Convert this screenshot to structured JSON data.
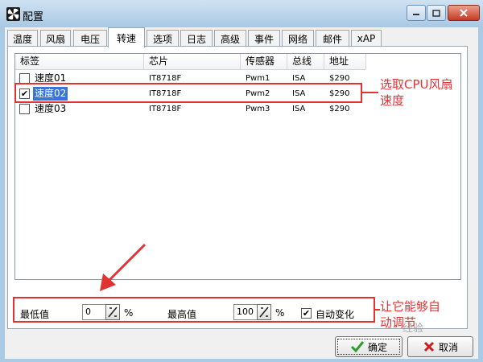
{
  "window": {
    "title": "配置"
  },
  "tabs": [
    {
      "label": "温度"
    },
    {
      "label": "风扇"
    },
    {
      "label": "电压"
    },
    {
      "label": "转速",
      "active": true
    },
    {
      "label": "选项"
    },
    {
      "label": "日志"
    },
    {
      "label": "高级"
    },
    {
      "label": "事件"
    },
    {
      "label": "网络"
    },
    {
      "label": "邮件"
    },
    {
      "label": "xAP"
    }
  ],
  "list": {
    "columns": [
      "标签",
      "芯片",
      "传感器",
      "总线",
      "地址"
    ],
    "rows": [
      {
        "label": "速度01",
        "chip": "IT8718F",
        "sensor": "Pwm1",
        "bus": "ISA",
        "address": "$290",
        "checked": false,
        "selected": false
      },
      {
        "label": "速度02",
        "chip": "IT8718F",
        "sensor": "Pwm2",
        "bus": "ISA",
        "address": "$290",
        "checked": true,
        "selected": true
      },
      {
        "label": "速度03",
        "chip": "IT8718F",
        "sensor": "Pwm3",
        "bus": "ISA",
        "address": "$290",
        "checked": false,
        "selected": false
      }
    ]
  },
  "controls": {
    "min_label": "最低值",
    "min_value": "0",
    "min_unit": "%",
    "max_label": "最高值",
    "max_value": "100",
    "max_unit": "%",
    "auto_label": "自动变化",
    "auto_checked": true
  },
  "buttons": {
    "ok": "确定",
    "cancel": "取消"
  },
  "annotations": {
    "select_cpu_fan": "选取CPU风扇速度",
    "auto_adjust": "让它能够自动调节"
  },
  "watermark": "经验",
  "colors": {
    "annotation": "#e33232",
    "selection": "#3875d7",
    "ok_check": "#2e9e2e",
    "cancel_x": "#c81e1e"
  }
}
